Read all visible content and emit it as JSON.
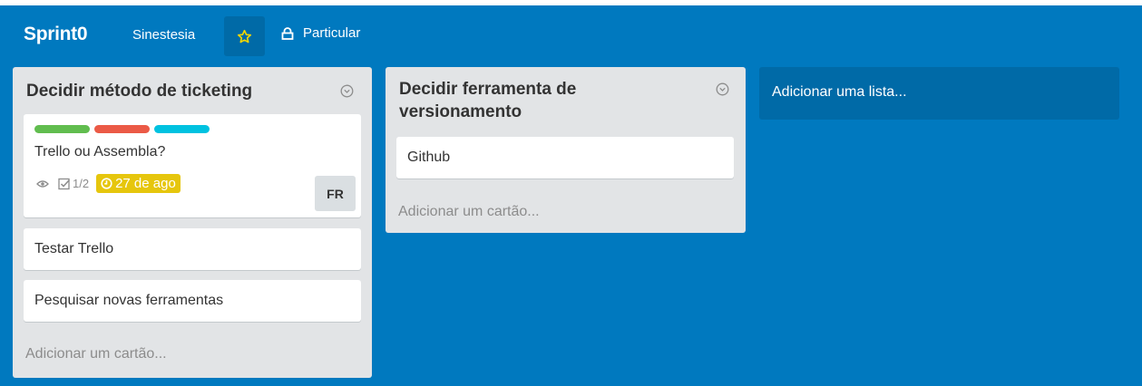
{
  "header": {
    "board_title": "Sprint0",
    "team_name": "Sinestesia",
    "star_icon": "star-icon",
    "visibility_label": "Particular",
    "visibility_icon": "lock-icon"
  },
  "lists": [
    {
      "title": "Decidir método de ticketing",
      "menu_icon": "chevron-down-circle-icon",
      "cards": [
        {
          "labels": [
            "#61bd4f",
            "#eb5a46",
            "#00c2e0"
          ],
          "title": "Trello ou Assembla?",
          "badges": {
            "watch_icon": "eye-icon",
            "checklist_icon": "checklist-icon",
            "checklist": "1/2",
            "due_icon": "clock-icon",
            "due": "27 de ago"
          },
          "member": "FR"
        },
        {
          "title": "Testar Trello"
        },
        {
          "title": "Pesquisar novas ferramentas"
        }
      ],
      "add_card": "Adicionar um cartão..."
    },
    {
      "title": "Decidir ferramenta de versionamento",
      "title_line1": "Decidir ferramenta de",
      "title_line2": "versionamento",
      "menu_icon": "chevron-down-circle-icon",
      "cards": [
        {
          "title": "Github"
        }
      ],
      "add_card": "Adicionar um cartão..."
    }
  ],
  "add_list": "Adicionar uma lista...",
  "colors": {
    "board_bg": "#0079bf",
    "list_bg": "#e2e4e6",
    "due_bg": "#e6c60d"
  }
}
